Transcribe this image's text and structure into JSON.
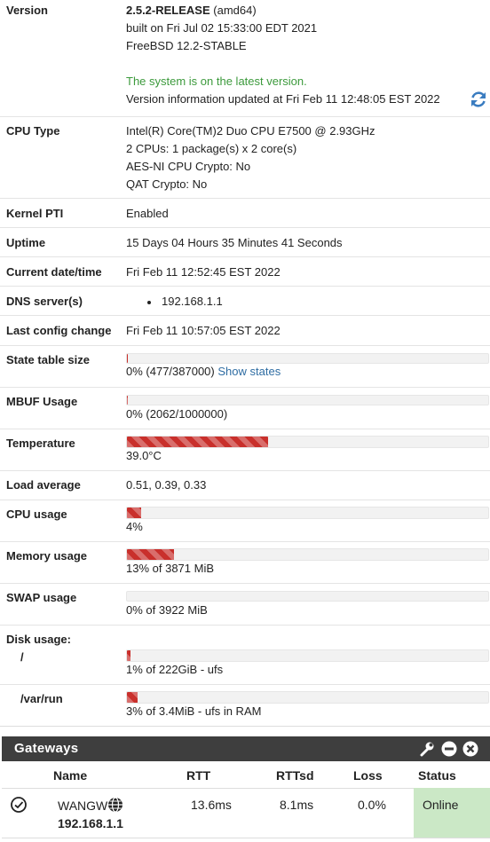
{
  "sysinfo": {
    "version": {
      "label": "Version",
      "release": "2.5.2-RELEASE",
      "arch": " (amd64)",
      "built": "built on Fri Jul 02 15:33:00 EDT 2021",
      "os": "FreeBSD 12.2-STABLE",
      "status": "The system is on the latest version.",
      "updated": "Version information updated at Fri Feb 11 12:48:05 EST 2022"
    },
    "cpu_type": {
      "label": "CPU Type",
      "model": "Intel(R) Core(TM)2 Duo CPU E7500 @ 2.93GHz",
      "cores": "2 CPUs: 1 package(s) x 2 core(s)",
      "aesni": "AES-NI CPU Crypto: No",
      "qat": "QAT Crypto: No"
    },
    "kernel_pti": {
      "label": "Kernel PTI",
      "value": "Enabled"
    },
    "uptime": {
      "label": "Uptime",
      "value": "15 Days 04 Hours 35 Minutes 41 Seconds"
    },
    "current_date": {
      "label": "Current date/time",
      "value": "Fri Feb 11 12:52:45 EST 2022"
    },
    "dns": {
      "label": "DNS server(s)",
      "servers": [
        "192.168.1.1"
      ]
    },
    "last_config": {
      "label": "Last config change",
      "value": "Fri Feb 11 10:57:05 EST 2022"
    },
    "state_table": {
      "label": "State table size",
      "text": "0% (477/387000)",
      "link": "Show states",
      "fraction": 0.0012
    },
    "mbuf": {
      "label": "MBUF Usage",
      "text": "0% (2062/1000000)",
      "fraction": 0.002
    },
    "temperature": {
      "label": "Temperature",
      "text": "39.0°C",
      "fraction": 0.39
    },
    "load_average": {
      "label": "Load average",
      "value": "0.51, 0.39, 0.33"
    },
    "cpu_usage": {
      "label": "CPU usage",
      "text": "4%",
      "fraction": 0.04
    },
    "memory_usage": {
      "label": "Memory usage",
      "text": "13% of 3871 MiB",
      "fraction": 0.13
    },
    "swap_usage": {
      "label": "SWAP usage",
      "text": "0% of 3922 MiB",
      "fraction": 0.0
    },
    "disk_usage": {
      "label": "Disk usage:",
      "disks": [
        {
          "mount": "/",
          "text": "1% of 222GiB - ufs",
          "fraction": 0.01
        },
        {
          "mount": "/var/run",
          "text": "3% of 3.4MiB - ufs in RAM",
          "fraction": 0.03
        }
      ]
    }
  },
  "gateways": {
    "title": "Gateways",
    "icons": [
      "wrench-icon",
      "minus-circle-icon",
      "close-circle-icon"
    ],
    "columns": [
      "Name",
      "RTT",
      "RTTsd",
      "Loss",
      "Status"
    ],
    "rows": [
      {
        "name": "WANGW",
        "ip": "192.168.1.1",
        "rtt": "13.6ms",
        "rttsd": "8.1ms",
        "loss": "0.0%",
        "status": "Online"
      }
    ],
    "status_online_color": "#cbe8c6"
  },
  "colors": {
    "bar_fill": "#c9302c",
    "link": "#2f6da3",
    "ok_text": "#3c9a3c",
    "header_bg": "#3e3e3e"
  }
}
